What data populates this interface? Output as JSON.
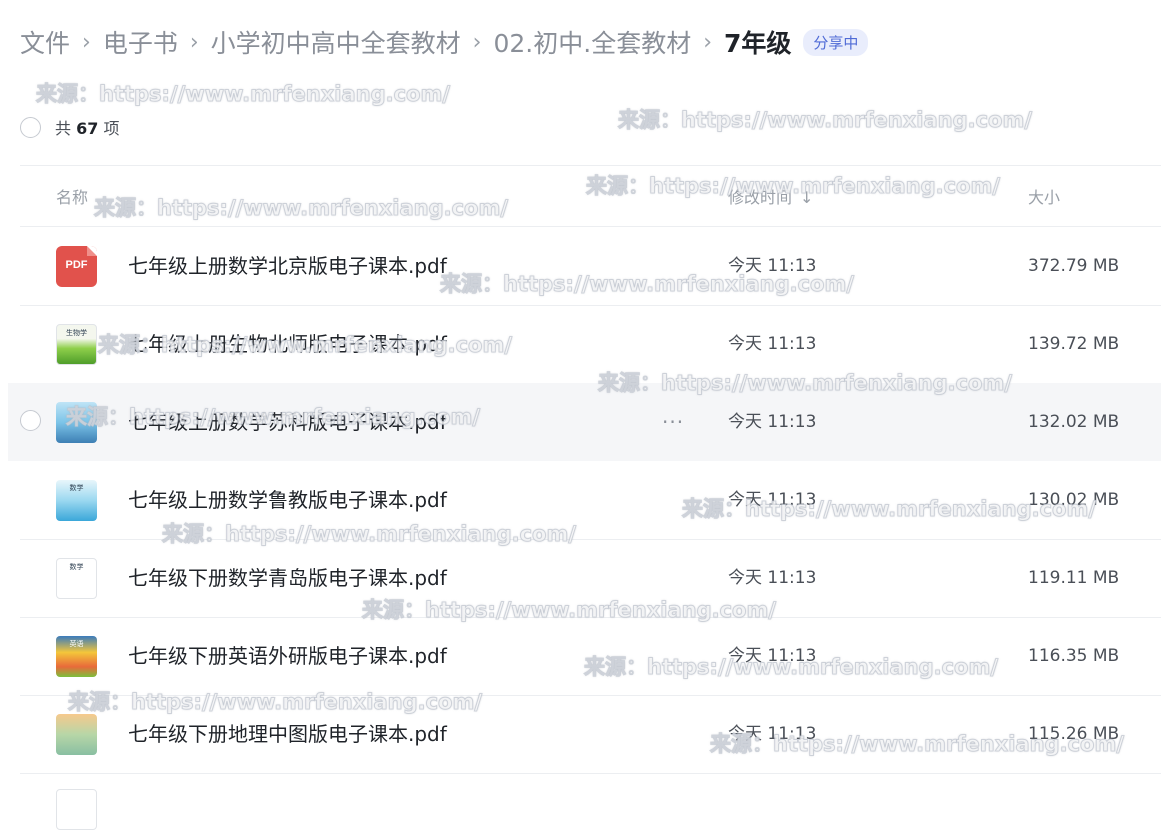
{
  "breadcrumb": {
    "items": [
      "文件",
      "电子书",
      "小学初中高中全套教材",
      "02.初中.全套教材"
    ],
    "separator": "›",
    "current": "7年级",
    "share_badge": "分享中"
  },
  "summary": {
    "prefix": "共",
    "count": "67",
    "suffix": "项"
  },
  "columns": {
    "name": "名称",
    "modified": "修改时间",
    "sort_indicator": "↓",
    "size": "大小"
  },
  "files": [
    {
      "name": "七年级上册数学北京版电子课本.pdf",
      "modified": "今天 11:13",
      "size": "372.79 MB",
      "thumb": "pdf-icon",
      "thumb_label": "PDF"
    },
    {
      "name": "七年级上册生物北师版电子课本.pdf",
      "modified": "今天 11:13",
      "size": "139.72 MB",
      "thumb": "biology-cover-thumbnail",
      "thumb_label": "生物学"
    },
    {
      "name": "七年级上册数学苏科版电子课本.pdf",
      "modified": "今天 11:13",
      "size": "132.02 MB",
      "thumb": "math-cover-thumbnail",
      "thumb_label": "",
      "more": "···"
    },
    {
      "name": "七年级上册数学鲁教版电子课本.pdf",
      "modified": "今天 11:13",
      "size": "130.02 MB",
      "thumb": "math-cover-thumbnail",
      "thumb_label": "数学"
    },
    {
      "name": "七年级下册数学青岛版电子课本.pdf",
      "modified": "今天 11:13",
      "size": "119.11 MB",
      "thumb": "math-cover-thumbnail",
      "thumb_label": "数学"
    },
    {
      "name": "七年级下册英语外研版电子课本.pdf",
      "modified": "今天 11:13",
      "size": "116.35 MB",
      "thumb": "english-cover-thumbnail",
      "thumb_label": "英语"
    },
    {
      "name": "七年级下册地理中图版电子课本.pdf",
      "modified": "今天 11:13",
      "size": "115.26 MB",
      "thumb": "geography-cover-thumbnail",
      "thumb_label": ""
    }
  ],
  "watermark": "来源：https://www.mrfenxiang.com/",
  "colors": {
    "badge_text": "#4f6bd6",
    "badge_bg": "#e9edfc",
    "pdf_icon": "#e1524c",
    "hover_row_bg": "#f5f6f8"
  }
}
